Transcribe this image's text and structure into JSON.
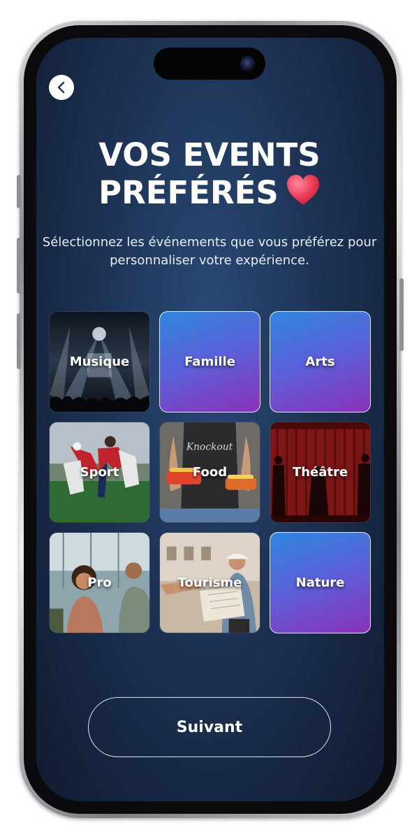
{
  "header": {
    "back_icon": "chevron-left-icon",
    "title_line1": "VOS EVENTS",
    "title_line2": "PRÉFÉRÉS",
    "title_emoji": "heart-icon"
  },
  "subtitle": "Sélectionnez les événements que vous préférez pour personnaliser votre expérience.",
  "categories": [
    {
      "label": "Musique",
      "style": "photo"
    },
    {
      "label": "Famille",
      "style": "gradient"
    },
    {
      "label": "Arts",
      "style": "gradient"
    },
    {
      "label": "Sport",
      "style": "photo"
    },
    {
      "label": "Food",
      "style": "photo"
    },
    {
      "label": "Théâtre",
      "style": "photo"
    },
    {
      "label": "Pro",
      "style": "photo"
    },
    {
      "label": "Tourisme",
      "style": "photo"
    },
    {
      "label": "Nature",
      "style": "gradient"
    }
  ],
  "footer": {
    "next_label": "Suivant"
  },
  "colors": {
    "accent_blue": "#2f86e0",
    "accent_purple": "#8a31b8",
    "background": "#1d3355",
    "heart": "#f0405e"
  }
}
